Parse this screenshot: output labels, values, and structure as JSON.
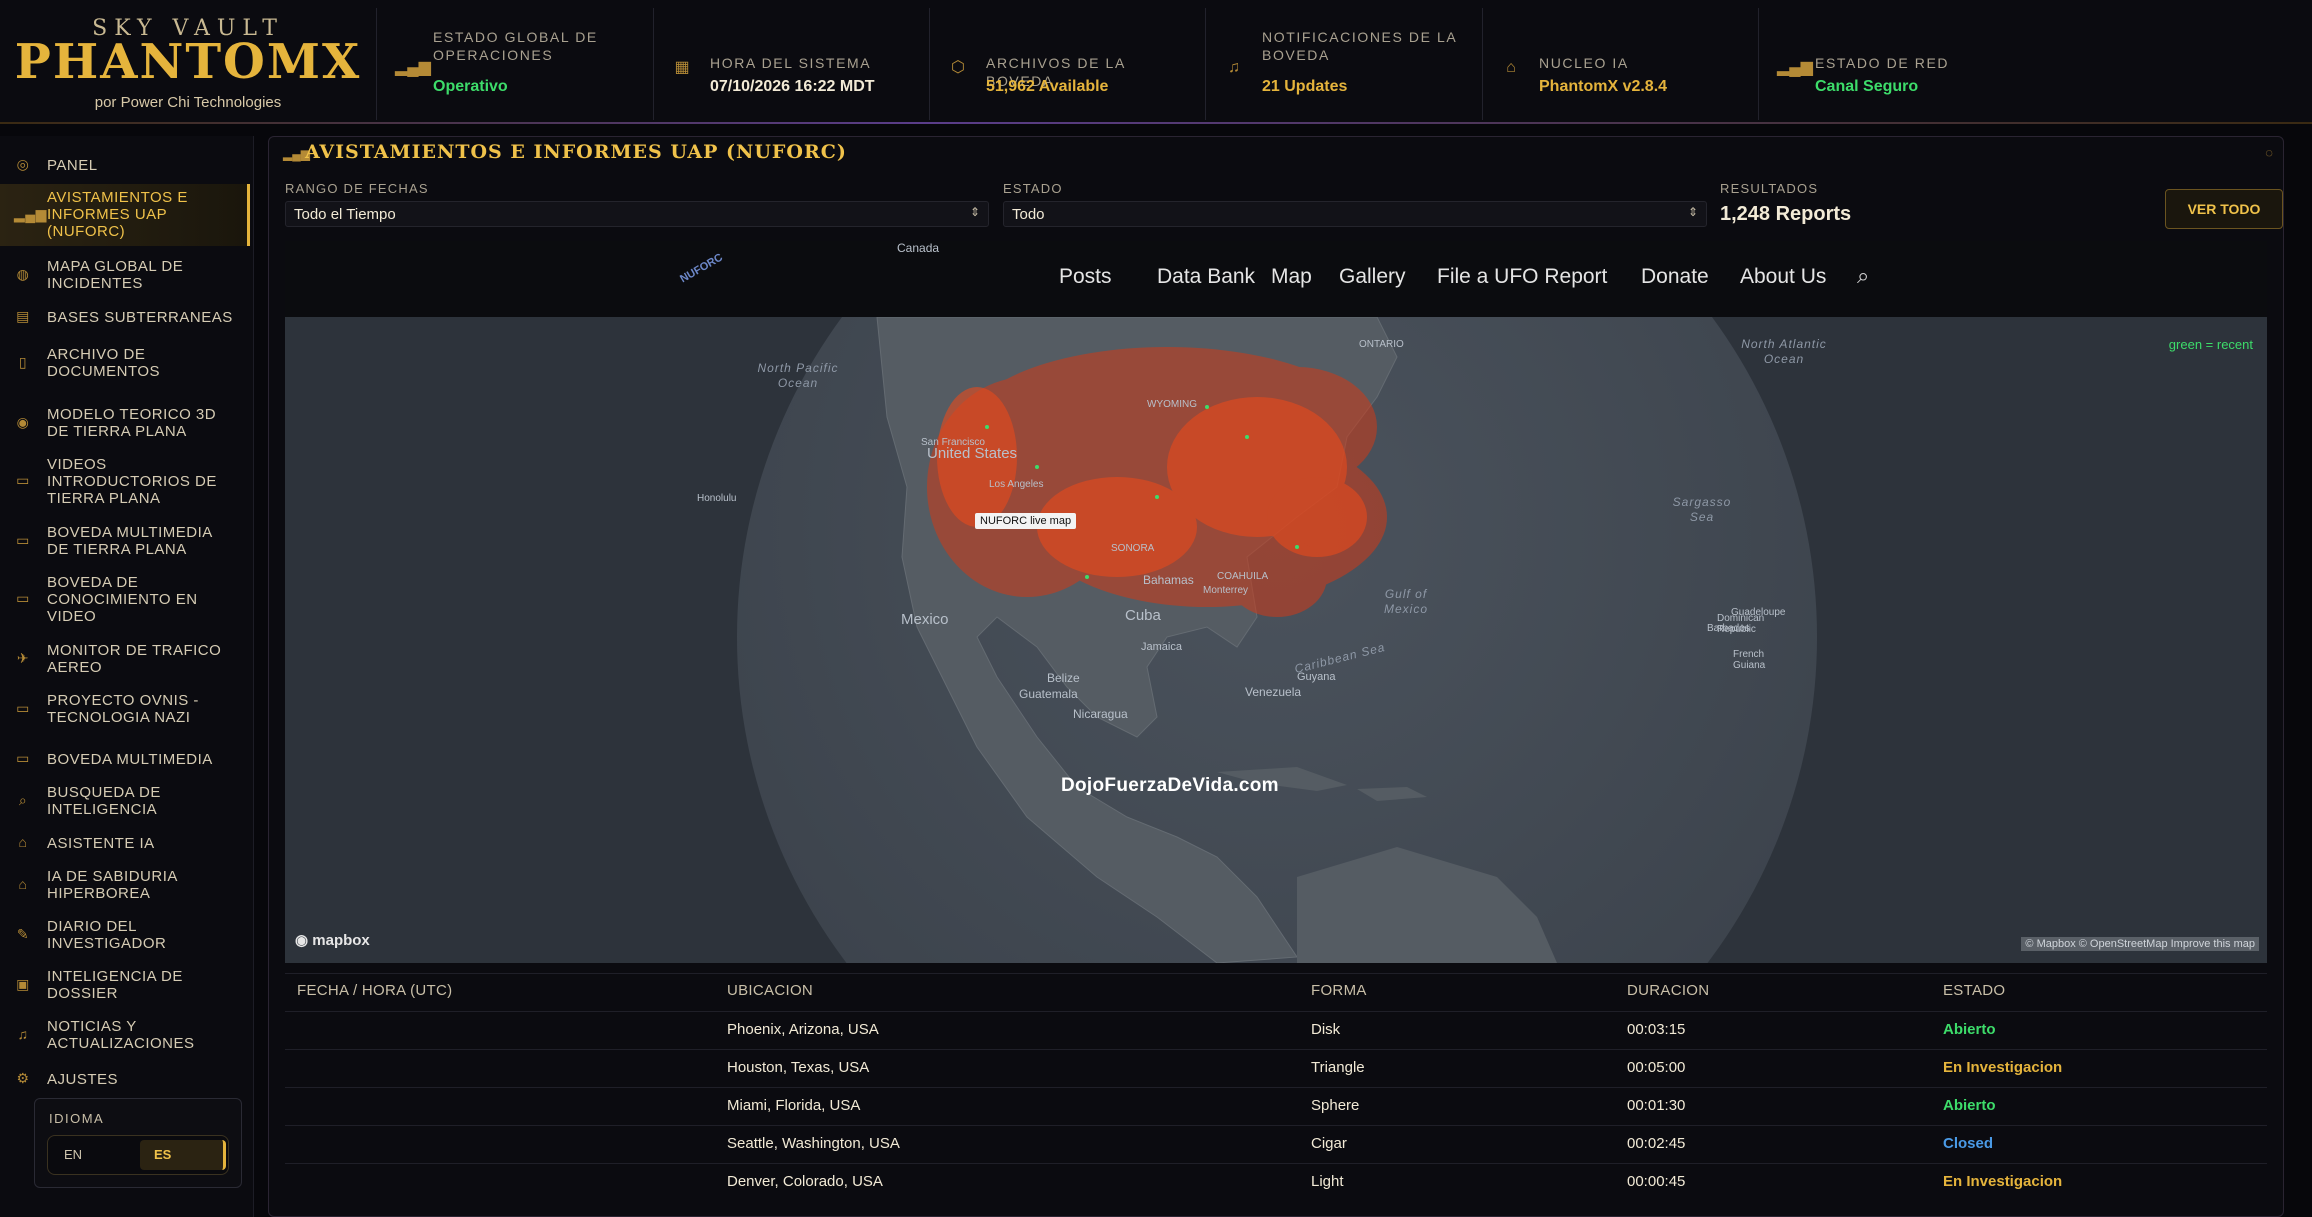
{
  "brand": {
    "line1": "SKY VAULT",
    "line2": "PHANTOMX",
    "line3": "por Power Chi Technologies"
  },
  "stats": [
    {
      "label": "ESTADO GLOBAL DE OPERACIONES",
      "value": "Operativo",
      "icon": "signal-bars-icon"
    },
    {
      "label": "HORA DEL SISTEMA",
      "value": "07/10/2026 16:22 MDT",
      "icon": "calendar-icon"
    },
    {
      "label": "ARCHIVOS DE LA BOVEDA",
      "value": "51,962 Available",
      "icon": "shield-icon"
    },
    {
      "label": "NOTIFICACIONES DE LA BOVEDA",
      "value": "21 Updates",
      "icon": "bell-icon"
    },
    {
      "label": "NUCLEO IA",
      "value": "PhantomX v2.8.4",
      "icon": "robot-icon"
    },
    {
      "label": "ESTADO DE RED",
      "value": "Canal Seguro",
      "icon": "signal-bars-icon"
    }
  ],
  "sidebar": {
    "items": [
      {
        "label": "Panel"
      },
      {
        "label": "Avistamientos e Informes UAP (NUFORC)"
      },
      {
        "label": "Mapa Global de Incidentes"
      },
      {
        "label": "Bases Subterraneas"
      },
      {
        "label": "Archivo de Documentos"
      },
      {
        "label": "Modelo Teorico 3D de Tierra Plana"
      },
      {
        "label": "Videos Introductorios de Tierra Plana"
      },
      {
        "label": "Boveda Multimedia de Tierra Plana"
      },
      {
        "label": "Boveda de Conocimiento en Video"
      },
      {
        "label": "Monitor de Trafico Aereo"
      },
      {
        "label": "Proyecto OVNIS - Tecnologia Nazi"
      },
      {
        "label": "Boveda Multimedia"
      },
      {
        "label": "Busqueda de Inteligencia"
      },
      {
        "label": "Asistente IA"
      },
      {
        "label": "IA de Sabiduria Hiperborea"
      },
      {
        "label": "Diario del Investigador"
      },
      {
        "label": "Inteligencia de Dossier"
      },
      {
        "label": "Noticias y Actualizaciones"
      },
      {
        "label": "Ajustes"
      }
    ],
    "language": {
      "title": "IDIOMA",
      "en": "EN",
      "es": "ES"
    }
  },
  "panel": {
    "title": "AVISTAMIENTOS E INFORMES UAP (NUFORC)",
    "date_label": "RANGO DE FECHAS",
    "date_value": "Todo el Tiempo",
    "status_label": "ESTADO",
    "status_value": "Todo",
    "results_label": "RESULTADOS",
    "results_value": "1,248 Reports",
    "view_all": "VER TODO"
  },
  "embed": {
    "logo": "NUFORC",
    "nav": [
      "Posts",
      "Data Bank",
      "Map",
      "Gallery",
      "File a UFO Report",
      "Donate",
      "About Us"
    ],
    "legend": "green = recent",
    "tooltip": "NUFORC live map",
    "watermark": "DojoFuerzaDeVida.com",
    "mapbox": "mapbox",
    "attribution": "© Mapbox © OpenStreetMap Improve this map",
    "places": [
      "Canada",
      "United States",
      "Mexico",
      "Cuba",
      "Bahamas",
      "Jamaica",
      "Guatemala",
      "Belize",
      "Nicaragua",
      "Venezuela",
      "Guyana",
      "Honolulu",
      "San Francisco",
      "Los Angeles",
      "Monterrey",
      "Dominican Republic",
      "Barbados",
      "Guadeloupe",
      "French Guiana",
      "ONTARIO",
      "WYOMING",
      "SONORA",
      "COAHUILA"
    ],
    "oceans": [
      "North Pacific Ocean",
      "North Atlantic Ocean",
      "Gulf of Mexico",
      "Caribbean Sea",
      "Sargasso Sea"
    ]
  },
  "table": {
    "headers": [
      "FECHA / HORA (UTC)",
      "UBICACION",
      "FORMA",
      "DURACION",
      "ESTADO"
    ],
    "rows": [
      {
        "date": "",
        "location": "Phoenix, Arizona, USA",
        "shape": "Disk",
        "duration": "00:03:15",
        "status": "Abierto",
        "color": "#3ddc6a"
      },
      {
        "date": "",
        "location": "Houston, Texas, USA",
        "shape": "Triangle",
        "duration": "00:05:00",
        "status": "En Investigacion",
        "color": "#e5b43c"
      },
      {
        "date": "",
        "location": "Miami, Florida, USA",
        "shape": "Sphere",
        "duration": "00:01:30",
        "status": "Abierto",
        "color": "#3ddc6a"
      },
      {
        "date": "",
        "location": "Seattle, Washington, USA",
        "shape": "Cigar",
        "duration": "00:02:45",
        "status": "Closed",
        "color": "#4a9ae6"
      },
      {
        "date": "",
        "location": "Denver, Colorado, USA",
        "shape": "Light",
        "duration": "00:00:45",
        "status": "En Investigacion",
        "color": "#e5b43c"
      }
    ]
  }
}
